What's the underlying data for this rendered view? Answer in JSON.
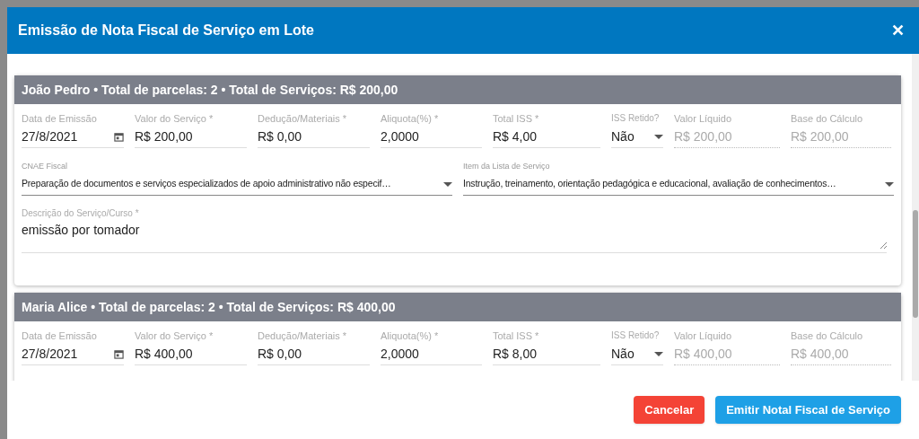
{
  "dialog": {
    "title": "Emissão de Nota Fiscal de Serviço em Lote",
    "close": "✕"
  },
  "cards": [
    {
      "header": "João Pedro • Total de parcelas: 2 • Total de Serviços: R$ 200,00",
      "fields": [
        {
          "kind": "date",
          "label": "Data de Emissão",
          "value": "27/8/2021",
          "disabled": false
        },
        {
          "kind": "text",
          "label": "Valor do Serviço *",
          "value": "R$ 200,00",
          "disabled": false
        },
        {
          "kind": "text",
          "label": "Dedução/Materiais *",
          "value": "R$ 0,00",
          "disabled": false
        },
        {
          "kind": "text",
          "label": "Aliquota(%) *",
          "value": "2,0000",
          "disabled": false
        },
        {
          "kind": "text",
          "label": "Total ISS *",
          "value": "R$ 4,00",
          "disabled": false
        },
        {
          "kind": "select",
          "label": "ISS Retido?",
          "value": "Não",
          "disabled": false
        },
        {
          "kind": "text",
          "label": "Valor Líquido",
          "value": "R$ 200,00",
          "disabled": true
        },
        {
          "kind": "text",
          "label": "Base do Cálculo",
          "value": "R$ 200,00",
          "disabled": true
        }
      ],
      "selects": [
        {
          "label": "CNAE Fiscal",
          "value": "Preparação de documentos e serviços especializados de apoio administrativo não especif…"
        },
        {
          "label": "Item da Lista de Serviço",
          "value": "Instrução, treinamento, orientação pedagógica e educacional, avaliação de conhecimentos…"
        }
      ],
      "description": {
        "label": "Descrição do Serviço/Curso *",
        "value": "emissão por tomador"
      }
    },
    {
      "header": "Maria Alice • Total de parcelas: 2 • Total de Serviços: R$ 400,00",
      "fields": [
        {
          "kind": "date",
          "label": "Data de Emissão",
          "value": "27/8/2021",
          "disabled": false
        },
        {
          "kind": "text",
          "label": "Valor do Serviço *",
          "value": "R$ 400,00",
          "disabled": false
        },
        {
          "kind": "text",
          "label": "Dedução/Materiais *",
          "value": "R$ 0,00",
          "disabled": false
        },
        {
          "kind": "text",
          "label": "Aliquota(%) *",
          "value": "2,0000",
          "disabled": false
        },
        {
          "kind": "text",
          "label": "Total ISS *",
          "value": "R$ 8,00",
          "disabled": false
        },
        {
          "kind": "select",
          "label": "ISS Retido?",
          "value": "Não",
          "disabled": false
        },
        {
          "kind": "text",
          "label": "Valor Líquido",
          "value": "R$ 400,00",
          "disabled": true
        },
        {
          "kind": "text",
          "label": "Base do Cálculo",
          "value": "R$ 400,00",
          "disabled": true
        }
      ]
    }
  ],
  "buttons": [
    {
      "kind": "cancel",
      "label": "Cancelar"
    },
    {
      "kind": "submit",
      "label": "Emitir Notal Fiscal de Serviço"
    }
  ]
}
